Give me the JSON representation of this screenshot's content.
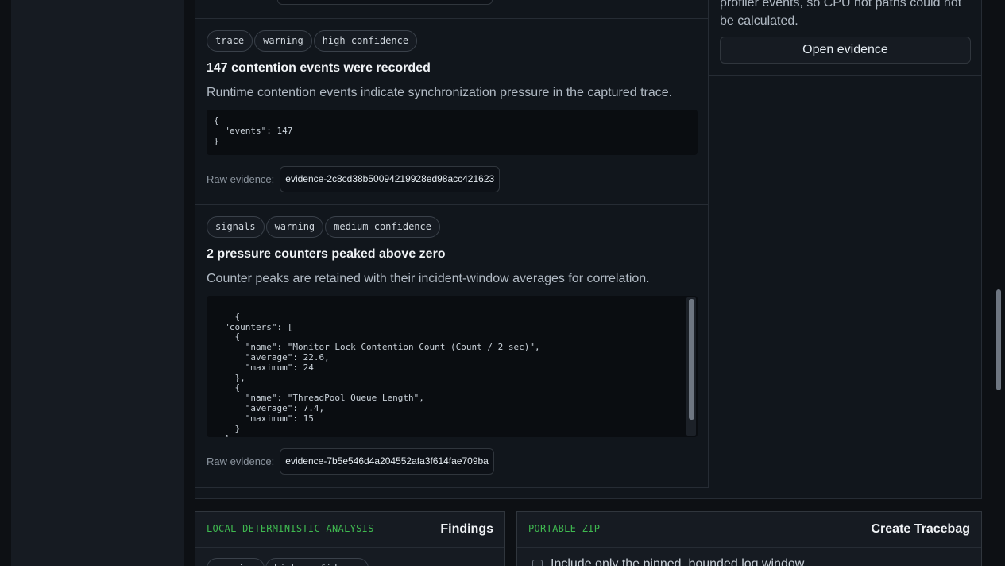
{
  "findings": [
    {
      "tags": [
        "trace",
        "warning",
        "high confidence"
      ],
      "title": "147 contention events were recorded",
      "description": "Runtime contention events indicate synchronization pressure in the captured trace.",
      "code": "{\n  \"events\": 147\n}",
      "raw_label": "Raw evidence:",
      "raw_id": "evidence-2c8cd38b50094219928ed98acc421623"
    },
    {
      "tags": [
        "signals",
        "warning",
        "medium confidence"
      ],
      "title": "2 pressure counters peaked above zero",
      "description": "Counter peaks are retained with their incident-window averages for correlation.",
      "code": "{\n  \"counters\": [\n    {\n      \"name\": \"Monitor Lock Contention Count (Count / 2 sec)\",\n      \"average\": 22.6,\n      \"maximum\": 24\n    },\n    {\n      \"name\": \"ThreadPool Queue Length\",\n      \"average\": 7.4,\n      \"maximum\": 15\n    }\n  ]\n}",
      "raw_label": "Raw evidence:",
      "raw_id": "evidence-7b5e546d4a204552afa3f614fae709ba"
    }
  ],
  "side": {
    "text": "profiler events, so CPU hot paths could not be calculated.",
    "button": "Open evidence"
  },
  "cards": {
    "findings": {
      "eyebrow": "LOCAL DETERMINISTIC ANALYSIS",
      "title": "Findings",
      "tags": [
        "warning",
        "high confidence"
      ]
    },
    "tracebag": {
      "eyebrow": "PORTABLE ZIP",
      "title": "Create Tracebag",
      "checkbox_label": "Include only the pinned, bounded log window"
    }
  }
}
